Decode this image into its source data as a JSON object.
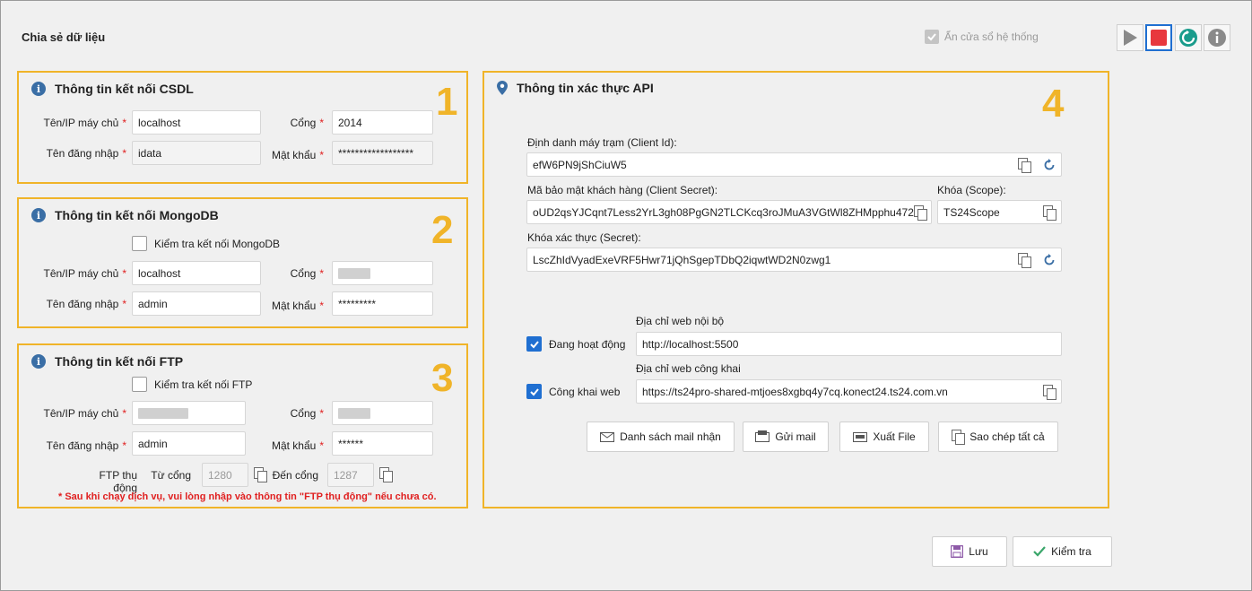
{
  "page": {
    "title": "Chia sẻ dữ liệu"
  },
  "toolbar": {
    "hide_system_tray_label": "Ẩn cửa sổ hệ thống",
    "play_icon": "play-icon",
    "stop_icon": "stop-icon",
    "restart_icon": "restart-icon",
    "info_icon": "info-icon"
  },
  "csdl": {
    "number": "1",
    "title": "Thông tin kết nối CSDL",
    "host_label": "Tên/IP máy chủ",
    "host_value": "localhost",
    "port_label": "Cổng",
    "port_value": "2014",
    "user_label": "Tên đăng nhập",
    "user_value": "idata",
    "password_label": "Mật khẩu",
    "password_value": "******************"
  },
  "mongodb": {
    "number": "2",
    "title": "Thông tin kết nối MongoDB",
    "check_label": "Kiểm tra kết nối MongoDB",
    "host_label": "Tên/IP máy chủ",
    "host_value": "localhost",
    "port_label": "Cổng",
    "user_label": "Tên đăng nhập",
    "user_value": "admin",
    "password_label": "Mật khẩu",
    "password_value": "*********"
  },
  "ftp": {
    "number": "3",
    "title": "Thông tin kết nối FTP",
    "check_label": "Kiểm tra kết nối FTP",
    "host_label": "Tên/IP máy chủ",
    "port_label": "Cổng",
    "user_label": "Tên đăng nhập",
    "user_value": "admin",
    "password_label": "Mật khẩu",
    "password_value": "******",
    "passive_label": "FTP thụ động",
    "from_port_label": "Từ cổng",
    "from_port_value": "1280",
    "to_port_label": "Đến cổng",
    "to_port_value": "1287",
    "note": "* Sau khi chạy dịch vụ, vui lòng nhập vào thông tin \"FTP thụ động\" nếu chưa có."
  },
  "api": {
    "number": "4",
    "title": "Thông tin xác thực API",
    "client_id_label": "Định danh máy trạm (Client Id):",
    "client_id_value": "efW6PN9jShCiuW5",
    "client_secret_label": "Mã bảo mật khách hàng (Client Secret):",
    "client_secret_value": "oUD2qsYJCqnt7Less2YrL3gh08PgGN2TLCKcq3roJMuA3VGtWl8ZHMpphu472",
    "scope_label": "Khóa (Scope):",
    "scope_value": "TS24Scope",
    "secret_label": "Khóa xác thực (Secret):",
    "secret_value": "LscZhIdVyadExeVRF5Hwr71jQhSgepTDbQ2iqwtWD2N0zwg1",
    "active_label": "Đang hoạt động",
    "internal_url_label": "Địa chỉ web nội bộ",
    "internal_url_value": "http://localhost:5500",
    "public_label": "Công khai web",
    "public_url_label": "Địa chỉ web công khai",
    "public_url_value": "https://ts24pro-shared-mtjoes8xgbq4y7cq.konect24.ts24.com.vn",
    "buttons": {
      "mail_list": "Danh sách mail nhận",
      "send_mail": "Gửi mail",
      "export_file": "Xuất File",
      "copy_all": "Sao chép tất cả"
    }
  },
  "footer": {
    "save_label": "Lưu",
    "check_label": "Kiểm tra"
  },
  "colors": {
    "accent_orange": "#f0b429",
    "primary_blue": "#1f6fd1",
    "stop_red": "#e8383d",
    "restart_teal": "#1a9c8c",
    "required_red": "#e02020"
  }
}
